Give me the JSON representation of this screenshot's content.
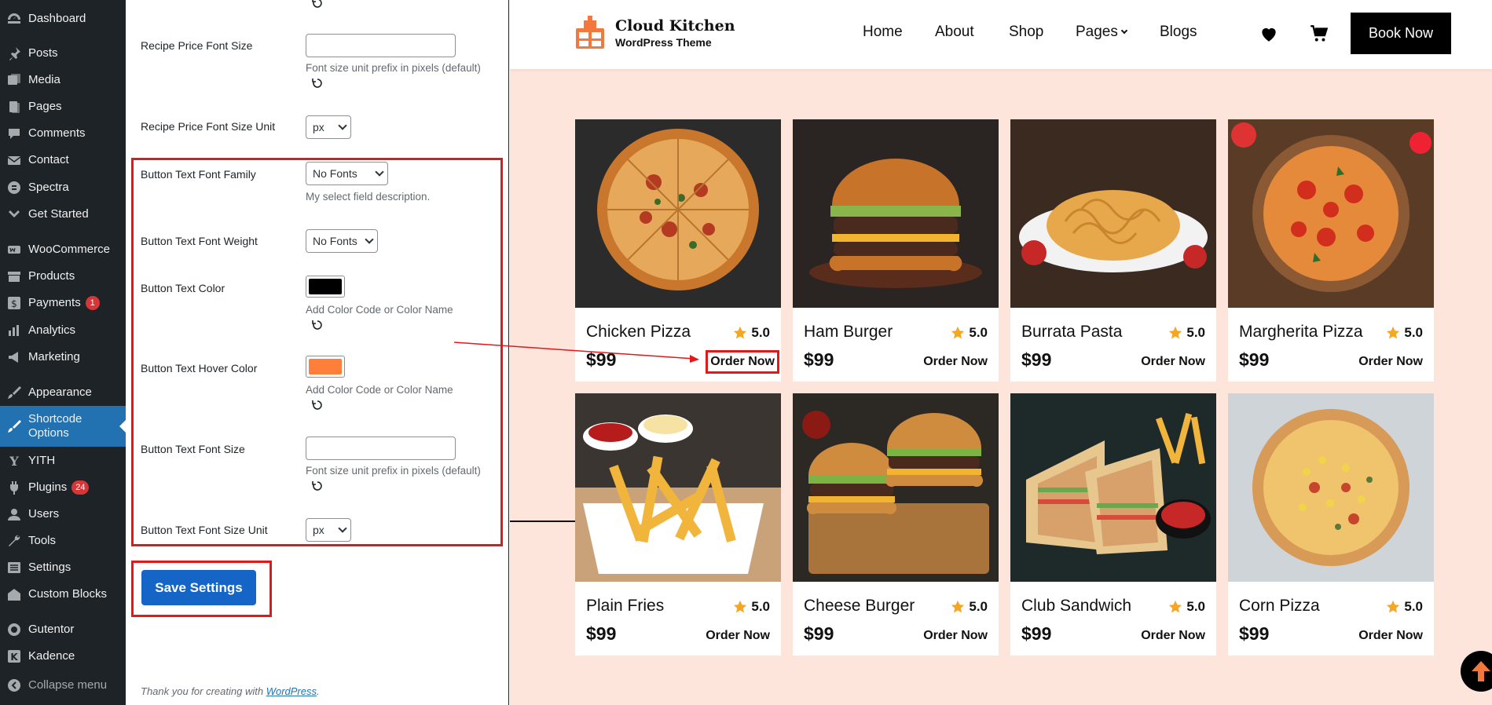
{
  "sidebar": {
    "items": [
      {
        "label": "Dashboard",
        "icon": "dashboard-icon"
      },
      {
        "label": "Posts",
        "icon": "pin-icon"
      },
      {
        "label": "Media",
        "icon": "media-icon"
      },
      {
        "label": "Pages",
        "icon": "pages-icon"
      },
      {
        "label": "Comments",
        "icon": "comments-icon"
      },
      {
        "label": "Contact",
        "icon": "mail-icon"
      },
      {
        "label": "Spectra",
        "icon": "spectra-icon"
      },
      {
        "label": "Get Started",
        "icon": "chevron-icon"
      },
      {
        "label": "WooCommerce",
        "icon": "woo-icon"
      },
      {
        "label": "Products",
        "icon": "archive-icon"
      },
      {
        "label": "Payments",
        "icon": "dollar-icon",
        "badge": "1"
      },
      {
        "label": "Analytics",
        "icon": "chart-icon"
      },
      {
        "label": "Marketing",
        "icon": "megaphone-icon"
      },
      {
        "label": "Appearance",
        "icon": "brush-icon"
      },
      {
        "label": "Shortcode Options",
        "icon": "brush-icon"
      },
      {
        "label": "YITH",
        "icon": "yith-icon"
      },
      {
        "label": "Plugins",
        "icon": "plugin-icon",
        "badge": "24"
      },
      {
        "label": "Users",
        "icon": "user-icon"
      },
      {
        "label": "Tools",
        "icon": "wrench-icon"
      },
      {
        "label": "Settings",
        "icon": "settings-icon"
      },
      {
        "label": "Custom Blocks",
        "icon": "blocks-icon"
      },
      {
        "label": "Gutentor",
        "icon": "gutentor-icon"
      },
      {
        "label": "Kadence",
        "icon": "kadence-icon"
      },
      {
        "label": "Collapse menu",
        "icon": "collapse-icon"
      }
    ],
    "active": "Shortcode Options"
  },
  "settings": {
    "recipe_price_font_size": {
      "label": "Recipe Price Font Size",
      "value": "",
      "desc": "Font size unit prefix in pixels (default)"
    },
    "recipe_price_font_size_unit": {
      "label": "Recipe Price Font Size Unit",
      "value": "px"
    },
    "button_text_font_family": {
      "label": "Button Text Font Family",
      "value": "No Fonts",
      "desc": "My select field description."
    },
    "button_text_font_weight": {
      "label": "Button Text Font Weight",
      "value": "No Fonts"
    },
    "button_text_color": {
      "label": "Button Text Color",
      "color": "#000000",
      "desc": "Add Color Code or Color Name"
    },
    "button_text_hover_color": {
      "label": "Button Text Hover Color",
      "color": "#ff7f3a",
      "desc": "Add Color Code or Color Name"
    },
    "button_text_font_size": {
      "label": "Button Text Font Size",
      "value": "",
      "desc": "Font size unit prefix in pixels (default)"
    },
    "button_text_font_size_unit": {
      "label": "Button Text Font Size Unit",
      "value": "px"
    },
    "save_label": "Save Settings",
    "footer_prefix": "Thank you for creating with ",
    "footer_link": "WordPress",
    "footer_suffix": "."
  },
  "site": {
    "brand": "Cloud Kitchen",
    "brand_sub": "WordPress Theme",
    "nav": [
      "Home",
      "About",
      "Shop",
      "Pages",
      "Blogs"
    ],
    "book_label": "Book Now",
    "accent": "#f4783b",
    "bg": "#fde5dc",
    "products": [
      {
        "name": "Chicken Pizza",
        "rating": "5.0",
        "price": "$99",
        "order": "Order Now",
        "image": "pizza"
      },
      {
        "name": "Ham Burger",
        "rating": "5.0",
        "price": "$99",
        "order": "Order Now",
        "image": "burger"
      },
      {
        "name": "Burrata Pasta",
        "rating": "5.0",
        "price": "$99",
        "order": "Order Now",
        "image": "pasta"
      },
      {
        "name": "Margherita Pizza",
        "rating": "5.0",
        "price": "$99",
        "order": "Order Now",
        "image": "pizza2"
      },
      {
        "name": "Plain Fries",
        "rating": "5.0",
        "price": "$99",
        "order": "Order Now",
        "image": "fries"
      },
      {
        "name": "Cheese Burger",
        "rating": "5.0",
        "price": "$99",
        "order": "Order Now",
        "image": "burgers"
      },
      {
        "name": "Club Sandwich",
        "rating": "5.0",
        "price": "$99",
        "order": "Order Now",
        "image": "sandwich"
      },
      {
        "name": "Corn Pizza",
        "rating": "5.0",
        "price": "$99",
        "order": "Order Now",
        "image": "pizza3"
      }
    ]
  }
}
